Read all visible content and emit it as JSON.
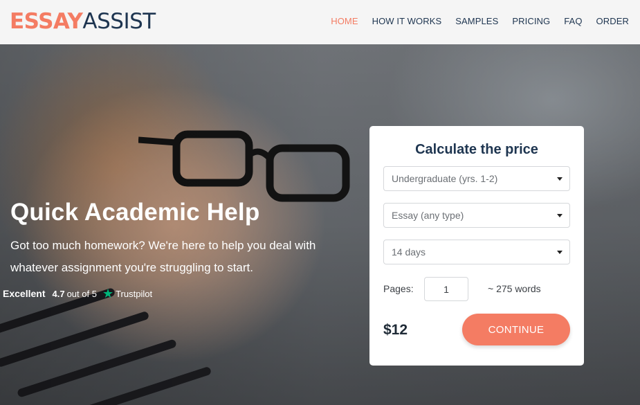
{
  "logo": {
    "part1": "ESSAY",
    "part2": "ASSIST"
  },
  "nav": [
    {
      "label": "HOME",
      "active": true
    },
    {
      "label": "HOW IT WORKS"
    },
    {
      "label": "SAMPLES"
    },
    {
      "label": "PRICING"
    },
    {
      "label": "FAQ"
    },
    {
      "label": "ORDER"
    }
  ],
  "hero": {
    "title": "Quick Academic Help",
    "subtitle": "Got too much homework? We're here to help you deal with whatever assignment you're struggling to start."
  },
  "rating": {
    "label": "Excellent",
    "score": "4.7",
    "out_of": "out of 5",
    "star_icon": "★",
    "brand": "Trustpilot",
    "brand_color": "#00b67a"
  },
  "calculator": {
    "title": "Calculate the price",
    "academic_level": "Undergraduate (yrs. 1-2)",
    "paper_type": "Essay (any type)",
    "deadline": "14 days",
    "pages_label": "Pages:",
    "pages_value": "1",
    "words": "~ 275 words",
    "price": "$12",
    "continue_label": "CONTINUE"
  },
  "colors": {
    "accent": "#f47c63",
    "navy": "#1e3550",
    "trustpilot": "#00b67a"
  }
}
